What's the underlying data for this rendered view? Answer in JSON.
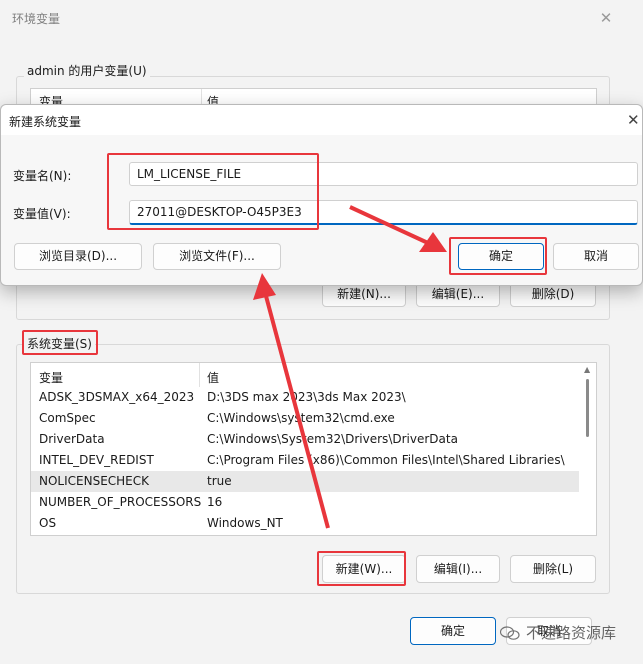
{
  "env_window": {
    "title": "环境变量",
    "user_group_label": "admin 的用户变量(U)",
    "user_columns": [
      "变量",
      "值"
    ],
    "user_buttons": {
      "new": "新建(N)...",
      "edit": "编辑(E)...",
      "delete": "删除(D)"
    },
    "system_group_label": "系统变量(S)",
    "system_columns": [
      "变量",
      "值"
    ],
    "system_rows": [
      {
        "name": "ADSK_3DSMAX_x64_2023",
        "value": "D:\\3DS max 2023\\3ds Max 2023\\"
      },
      {
        "name": "ComSpec",
        "value": "C:\\Windows\\system32\\cmd.exe"
      },
      {
        "name": "DriverData",
        "value": "C:\\Windows\\System32\\Drivers\\DriverData"
      },
      {
        "name": "INTEL_DEV_REDIST",
        "value": "C:\\Program Files (x86)\\Common Files\\Intel\\Shared Libraries\\"
      },
      {
        "name": "NOLICENSECHECK",
        "value": "true"
      },
      {
        "name": "NUMBER_OF_PROCESSORS",
        "value": "16"
      },
      {
        "name": "OS",
        "value": "Windows_NT"
      }
    ],
    "system_buttons": {
      "new": "新建(W)...",
      "edit": "编辑(I)...",
      "delete": "删除(L)"
    },
    "footer_buttons": {
      "ok": "确定",
      "cancel": "取消"
    }
  },
  "dialog": {
    "title": "新建系统变量",
    "name_label": "变量名(N):",
    "name_value": "LM_LICENSE_FILE",
    "value_label": "变量值(V):",
    "value_value": "27011@DESKTOP-O45P3E3",
    "browse_dir": "浏览目录(D)...",
    "browse_file": "浏览文件(F)...",
    "ok": "确定",
    "cancel": "取消"
  },
  "watermark": "不速路资源库",
  "colors": {
    "annotation": "#e8363c",
    "accent": "#0067c0"
  }
}
